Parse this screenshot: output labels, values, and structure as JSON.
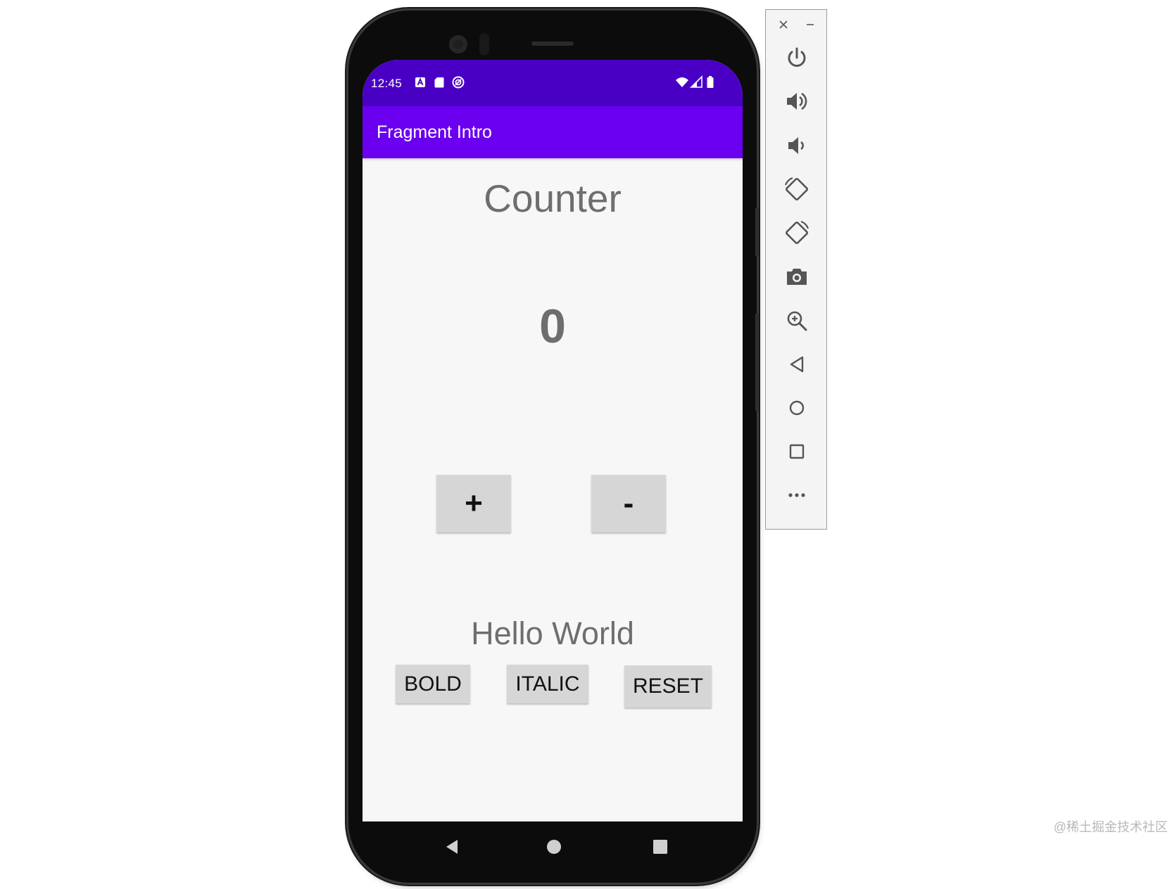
{
  "status_bar": {
    "time": "12:45",
    "left_icons": [
      "a-notification-icon",
      "sd-card-icon",
      "sync-icon"
    ],
    "right_icons": [
      "wifi-icon",
      "signal-icon",
      "battery-icon"
    ]
  },
  "app_bar": {
    "title": "Fragment Intro"
  },
  "counter": {
    "title": "Counter",
    "value": "0",
    "increment_label": "+",
    "decrement_label": "-"
  },
  "text_section": {
    "text": "Hello World",
    "bold_label": "BOLD",
    "italic_label": "ITALIC",
    "reset_label": "RESET"
  },
  "nav_bar": {
    "icons": [
      "back-icon",
      "home-icon",
      "recents-icon"
    ]
  },
  "emulator_toolbar": {
    "icons": [
      "close-icon",
      "minimize-icon",
      "power-icon",
      "volume-up-icon",
      "volume-down-icon",
      "rotate-left-icon",
      "rotate-right-icon",
      "camera-icon",
      "zoom-icon",
      "back-icon",
      "home-icon",
      "overview-icon",
      "more-icon"
    ]
  },
  "watermark": "@稀土掘金技术社区",
  "colors": {
    "status_bar": "#4a00c4",
    "app_bar": "#6a00ef",
    "screen_bg": "#f7f7f7",
    "button_bg": "#d6d6d6",
    "text_gray": "#6e6e6e"
  }
}
